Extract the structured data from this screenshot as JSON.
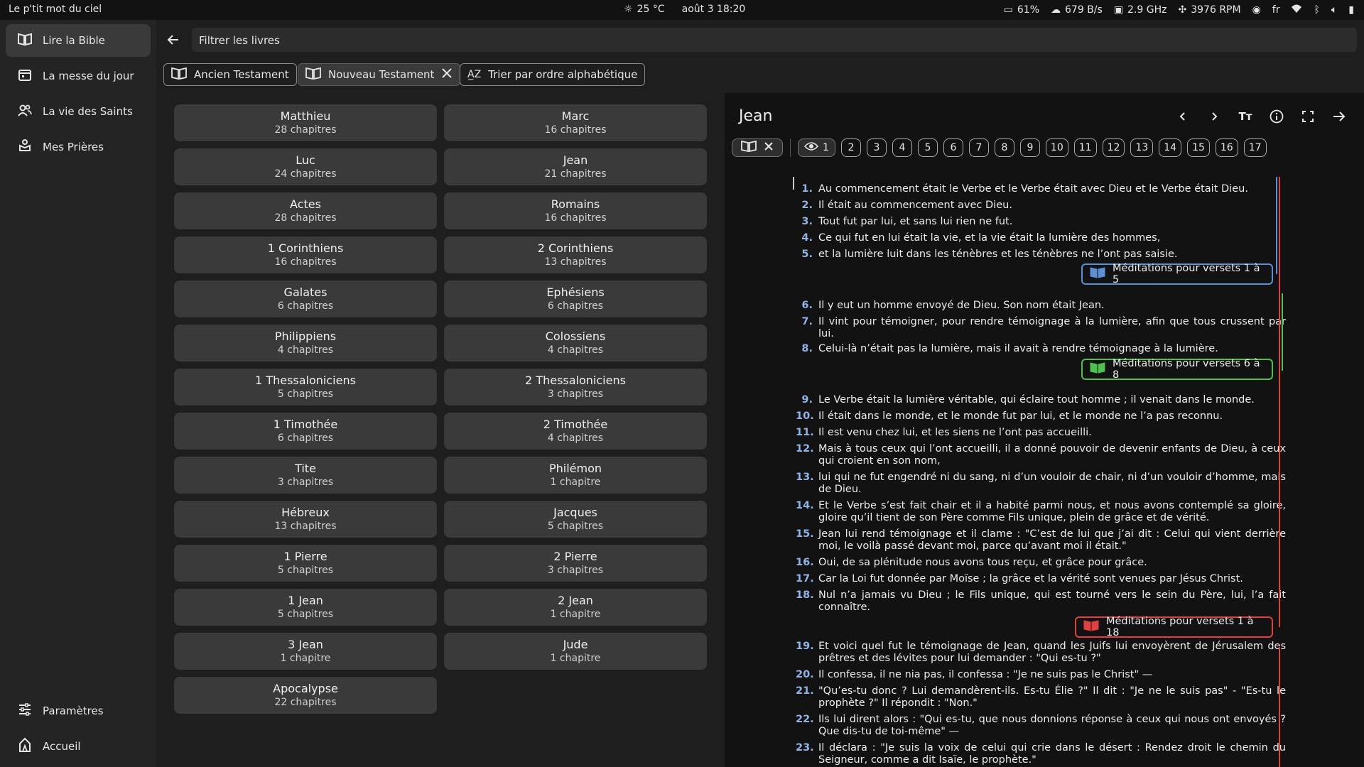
{
  "topbar": {
    "app_name": "Le p'tit mot du ciel",
    "weather": "25 °C",
    "date": "août 3  18:20",
    "battery_pct": "61%",
    "network": "679 B/s",
    "cpu": "2.9 GHz",
    "fan": "3976 RPM",
    "lang": "fr"
  },
  "sidebar": {
    "items": [
      {
        "label": "Lire la Bible",
        "icon": "book-icon",
        "active": true
      },
      {
        "label": "La messe du jour",
        "icon": "calendar-icon"
      },
      {
        "label": "La vie des Saints",
        "icon": "people-icon"
      },
      {
        "label": "Mes Prières",
        "icon": "hands-icon"
      }
    ],
    "bottom": [
      {
        "label": "Paramètres",
        "icon": "sliders-icon"
      },
      {
        "label": "Accueil",
        "icon": "home-icon"
      }
    ]
  },
  "filter": {
    "placeholder": "Filtrer les livres"
  },
  "chips": {
    "old": "Ancien Testament",
    "new": "Nouveau Testament",
    "sort": "Trier par ordre alphabétique"
  },
  "books": [
    {
      "name": "Matthieu",
      "chapters": "28 chapitres"
    },
    {
      "name": "Marc",
      "chapters": "16 chapitres"
    },
    {
      "name": "Luc",
      "chapters": "24 chapitres"
    },
    {
      "name": "Jean",
      "chapters": "21 chapitres"
    },
    {
      "name": "Actes",
      "chapters": "28 chapitres"
    },
    {
      "name": "Romains",
      "chapters": "16 chapitres"
    },
    {
      "name": "1 Corinthiens",
      "chapters": "16 chapitres"
    },
    {
      "name": "2 Corinthiens",
      "chapters": "13 chapitres"
    },
    {
      "name": "Galates",
      "chapters": "6 chapitres"
    },
    {
      "name": "Ephésiens",
      "chapters": "6 chapitres"
    },
    {
      "name": "Philippiens",
      "chapters": "4 chapitres"
    },
    {
      "name": "Colossiens",
      "chapters": "4 chapitres"
    },
    {
      "name": "1 Thessaloniciens",
      "chapters": "5 chapitres"
    },
    {
      "name": "2 Thessaloniciens",
      "chapters": "3 chapitres"
    },
    {
      "name": "1 Timothée",
      "chapters": "6 chapitres"
    },
    {
      "name": "2 Timothée",
      "chapters": "4 chapitres"
    },
    {
      "name": "Tite",
      "chapters": "3 chapitres"
    },
    {
      "name": "Philémon",
      "chapters": "1 chapitre"
    },
    {
      "name": "Hébreux",
      "chapters": "13 chapitres"
    },
    {
      "name": "Jacques",
      "chapters": "5 chapitres"
    },
    {
      "name": "1 Pierre",
      "chapters": "5 chapitres"
    },
    {
      "name": "2 Pierre",
      "chapters": "3 chapitres"
    },
    {
      "name": "1 Jean",
      "chapters": "5 chapitres"
    },
    {
      "name": "2 Jean",
      "chapters": "1 chapitre"
    },
    {
      "name": "3 Jean",
      "chapters": "1 chapitre"
    },
    {
      "name": "Jude",
      "chapters": "1 chapitre"
    },
    {
      "name": "Apocalypse",
      "chapters": "22 chapitres"
    }
  ],
  "reader": {
    "title": "Jean",
    "selected_chapter": "1",
    "chapters": [
      "2",
      "3",
      "4",
      "5",
      "6",
      "7",
      "8",
      "9",
      "10",
      "11",
      "12",
      "13",
      "14",
      "15",
      "16",
      "17"
    ],
    "verses": [
      {
        "n": "1.",
        "t": "Au commencement était le Verbe et le Verbe était avec Dieu et le Verbe était Dieu."
      },
      {
        "n": "2.",
        "t": "Il était au commencement avec Dieu."
      },
      {
        "n": "3.",
        "t": "Tout fut par lui, et sans lui rien ne fut."
      },
      {
        "n": "4.",
        "t": "Ce qui fut en lui était la vie, et la vie était la lumière des hommes,"
      },
      {
        "n": "5.",
        "t": "et la lumière luit dans les ténèbres et les ténèbres ne l’ont pas saisie."
      },
      {
        "n": "6.",
        "t": "Il y eut un homme envoyé de Dieu. Son nom était Jean."
      },
      {
        "n": "7.",
        "t": "Il vint pour témoigner, pour rendre témoignage à la lumière, afin que tous crussent par lui."
      },
      {
        "n": "8.",
        "t": "Celui-là n’était pas la lumière, mais il avait à rendre témoignage à la lumière."
      },
      {
        "n": "9.",
        "t": "Le Verbe était la lumière véritable, qui éclaire tout homme ; il venait dans le monde."
      },
      {
        "n": "10.",
        "t": "Il était dans le monde, et le monde fut par lui, et le monde ne l’a pas reconnu."
      },
      {
        "n": "11.",
        "t": "Il est venu chez lui, et les siens ne l’ont pas accueilli."
      },
      {
        "n": "12.",
        "t": "Mais à tous ceux qui l’ont accueilli, il a donné pouvoir de devenir enfants de Dieu, à ceux qui croient en son nom,"
      },
      {
        "n": "13.",
        "t": "lui qui ne fut engendré ni du sang, ni d’un vouloir de chair, ni d’un vouloir d’homme, mais de Dieu."
      },
      {
        "n": "14.",
        "t": "Et le Verbe s’est fait chair et il a habité parmi nous, et nous avons contemplé sa gloire, gloire qu’il tient de son Père comme Fils unique, plein de grâce et de vérité."
      },
      {
        "n": "15.",
        "t": "Jean lui rend témoignage et il clame : \"C’est de lui que j’ai dit : Celui qui vient derrière moi, le voilà passé devant moi, parce qu’avant moi il était.\""
      },
      {
        "n": "16.",
        "t": "Oui, de sa plénitude nous avons tous reçu, et grâce pour grâce."
      },
      {
        "n": "17.",
        "t": "Car la Loi fut donnée par Moïse ; la grâce et la vérité sont venues par Jésus Christ."
      },
      {
        "n": "18.",
        "t": "Nul n’a jamais vu Dieu ; le Fils unique, qui est tourné vers le sein du Père, lui, l’a fait connaître."
      },
      {
        "n": "19.",
        "t": "Et voici quel fut le témoignage de Jean, quand les Juifs lui envoyèrent de Jérusalem des prêtres et des lévites pour lui demander : \"Qui es-tu ?\""
      },
      {
        "n": "20.",
        "t": "Il confessa, il ne nia pas, il confessa : \"Je ne suis pas le Christ\" —"
      },
      {
        "n": "21.",
        "t": "\"Qu’es-tu donc ? Lui demandèrent-ils. Es-tu Élie ?\" Il dit : \"Je ne le suis pas\" - \"Es-tu le prophète ?\" Il répondit : \"Non.\""
      },
      {
        "n": "22.",
        "t": "Ils lui dirent alors : \"Qui es-tu, que nous donnions réponse à ceux qui nous ont envoyés ? Que dis-tu de toi-même\" —"
      },
      {
        "n": "23.",
        "t": "Il déclara : \"Je suis la voix de celui qui crie dans le désert : Rendez droit le chemin du Seigneur, comme a dit Isaïe, le prophète.\""
      }
    ],
    "meditations": [
      {
        "label": "Méditations pour versets 1 à 5",
        "color": "#5b8fd6"
      },
      {
        "label": "Méditations pour versets 6 à 8",
        "color": "#4cc24c"
      },
      {
        "label": "Méditations pour versets 1 à 18",
        "color": "#e04040"
      }
    ]
  }
}
